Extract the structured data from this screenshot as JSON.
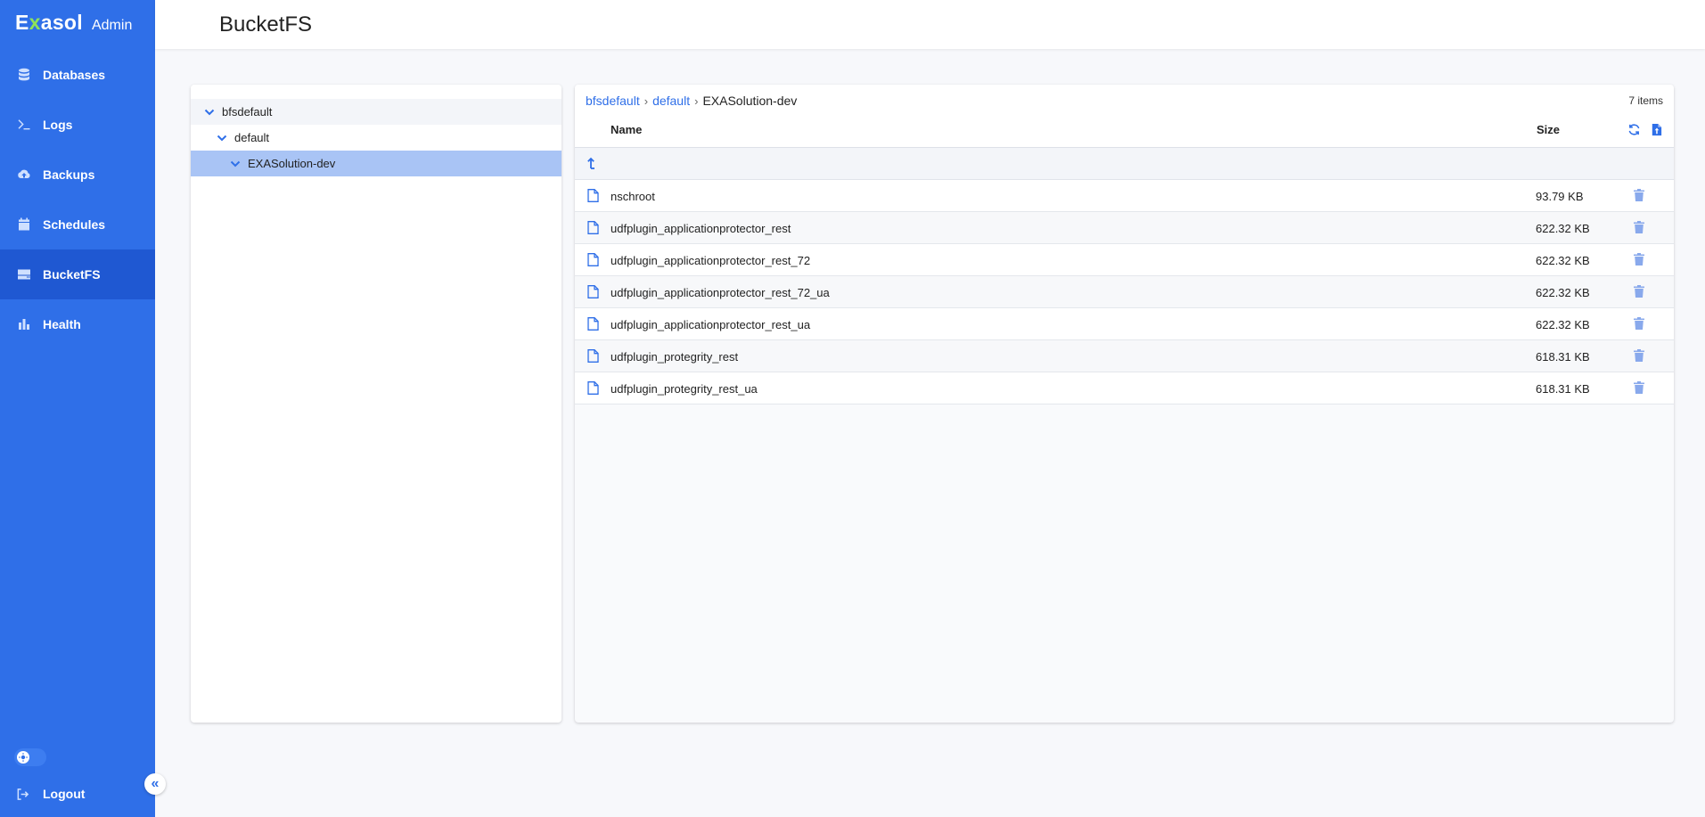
{
  "sidebar": {
    "brand": {
      "logo_e": "E",
      "logo_x": "x",
      "logo_rest": "asol",
      "admin": "Admin"
    },
    "items": [
      {
        "label": "Databases",
        "icon": "database-icon"
      },
      {
        "label": "Logs",
        "icon": "terminal-icon"
      },
      {
        "label": "Backups",
        "icon": "cloud-upload-icon"
      },
      {
        "label": "Schedules",
        "icon": "calendar-icon"
      },
      {
        "label": "BucketFS",
        "icon": "storage-icon",
        "active": true
      },
      {
        "label": "Health",
        "icon": "bar-chart-icon"
      }
    ],
    "logout": "Logout",
    "collapse_glyph": "«"
  },
  "header": {
    "title": "BucketFS"
  },
  "tree": {
    "nodes": [
      {
        "label": "bfsdefault",
        "level": 0
      },
      {
        "label": "default",
        "level": 1
      },
      {
        "label": "EXASolution-dev",
        "level": 2,
        "selected": true
      }
    ]
  },
  "files": {
    "breadcrumb": [
      "bfsdefault",
      "default",
      "EXASolution-dev"
    ],
    "breadcrumb_sep": "›",
    "count": "7 items",
    "columns": {
      "name": "Name",
      "size": "Size"
    },
    "rows": [
      {
        "name": "nschroot",
        "size": "93.79 KB"
      },
      {
        "name": "udfplugin_applicationprotector_rest",
        "size": "622.32 KB"
      },
      {
        "name": "udfplugin_applicationprotector_rest_72",
        "size": "622.32 KB"
      },
      {
        "name": "udfplugin_applicationprotector_rest_72_ua",
        "size": "622.32 KB"
      },
      {
        "name": "udfplugin_applicationprotector_rest_ua",
        "size": "622.32 KB"
      },
      {
        "name": "udfplugin_protegrity_rest",
        "size": "618.31 KB"
      },
      {
        "name": "udfplugin_protegrity_rest_ua",
        "size": "618.31 KB"
      }
    ]
  },
  "colors": {
    "accent": "#2f6fe8",
    "sidebar": "#2f6fe8",
    "sidebar_active": "#1f58d2",
    "selected_tree": "#a9c4f5",
    "brand_x": "#8fe35a"
  }
}
